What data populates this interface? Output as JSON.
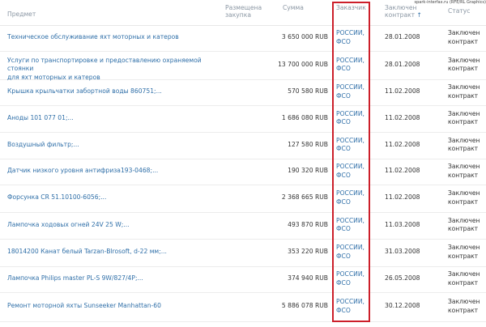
{
  "credit": "spark-interfax.ru (RFE/RL Graphics)",
  "header": {
    "subject": "Предмет",
    "placement_l1": "Размещена",
    "placement_l2": "закупка",
    "sum": "Сумма",
    "customer": "Заказчик",
    "contract_l1": "Заключен",
    "contract_l2": "контракт",
    "sort_arrow": "↑",
    "status": "Статус"
  },
  "rows": [
    {
      "subject_l1": "Техническое обслуживание яхт моторных и катеров",
      "subject_l2": "",
      "sum": "3 650 000 RUB",
      "customer_l1": "РОССИИ,",
      "customer_l2": "ФСО",
      "date": "28.01.2008",
      "status_l1": "Заключен",
      "status_l2": "контракт"
    },
    {
      "subject_l1": "Услуги по транспортировке и предоставлению охраняемой стоянки",
      "subject_l2": "для яхт моторных и катеров",
      "sum": "13 700 000 RUB",
      "customer_l1": "РОССИИ,",
      "customer_l2": "ФСО",
      "date": "28.01.2008",
      "status_l1": "Заключен",
      "status_l2": "контракт"
    },
    {
      "subject_l1": "Крышка крыльчатки забортной воды 860751;...",
      "subject_l2": "",
      "sum": "570 580 RUB",
      "customer_l1": "РОССИИ,",
      "customer_l2": "ФСО",
      "date": "11.02.2008",
      "status_l1": "Заключен",
      "status_l2": "контракт"
    },
    {
      "subject_l1": "Аноды 101 077 01;...",
      "subject_l2": "",
      "sum": "1 686 080 RUB",
      "customer_l1": "РОССИИ,",
      "customer_l2": "ФСО",
      "date": "11.02.2008",
      "status_l1": "Заключен",
      "status_l2": "контракт"
    },
    {
      "subject_l1": "Воздушный фильтр;...",
      "subject_l2": "",
      "sum": "127 580 RUB",
      "customer_l1": "РОССИИ,",
      "customer_l2": "ФСО",
      "date": "11.02.2008",
      "status_l1": "Заключен",
      "status_l2": "контракт"
    },
    {
      "subject_l1": "Датчик низкого уровня антифриза193-0468;...",
      "subject_l2": "",
      "sum": "190 320 RUB",
      "customer_l1": "РОССИИ,",
      "customer_l2": "ФСО",
      "date": "11.02.2008",
      "status_l1": "Заключен",
      "status_l2": "контракт"
    },
    {
      "subject_l1": "Форсунка CR 51.10100-6056;...",
      "subject_l2": "",
      "sum": "2 368 665 RUB",
      "customer_l1": "РОССИИ,",
      "customer_l2": "ФСО",
      "date": "11.02.2008",
      "status_l1": "Заключен",
      "status_l2": "контракт"
    },
    {
      "subject_l1": "Лампочка ходовых огней 24V 25 W;...",
      "subject_l2": "",
      "sum": "493 870 RUB",
      "customer_l1": "РОССИИ,",
      "customer_l2": "ФСО",
      "date": "11.03.2008",
      "status_l1": "Заключен",
      "status_l2": "контракт"
    },
    {
      "subject_l1": "18014200 Канат белый Tarzan-Blrosoft, d-22 мм;...",
      "subject_l2": "",
      "sum": "353 220 RUB",
      "customer_l1": "РОССИИ,",
      "customer_l2": "ФСО",
      "date": "31.03.2008",
      "status_l1": "Заключен",
      "status_l2": "контракт"
    },
    {
      "subject_l1": "Лампочка Philips master PL-S 9W/827/4P;...",
      "subject_l2": "",
      "sum": "374 940 RUB",
      "customer_l1": "РОССИИ,",
      "customer_l2": "ФСО",
      "date": "26.05.2008",
      "status_l1": "Заключен",
      "status_l2": "контракт"
    },
    {
      "subject_l1": "Ремонт моторной яхты Sunseeker Manhattan-60",
      "subject_l2": "",
      "sum": "5 886 078 RUB",
      "customer_l1": "РОССИИ,",
      "customer_l2": "ФСО",
      "date": "30.12.2008",
      "status_l1": "Заключен",
      "status_l2": "контракт"
    }
  ]
}
